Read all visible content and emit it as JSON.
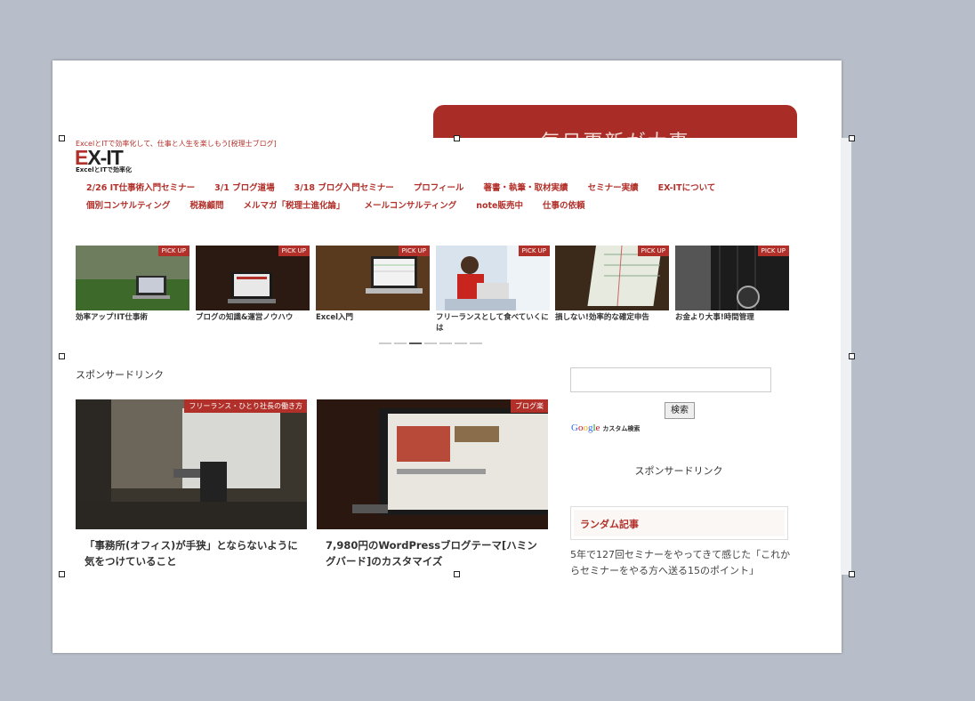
{
  "slide": {
    "banner_text": "毎日更新が大事"
  },
  "site": {
    "tagline": "ExcelとITで効率化して、仕事と人生を楽しもう[税理士ブログ]",
    "logo_main": "X-IT",
    "logo_e": "E",
    "logo_sub": "ExcelとITで効率化",
    "nav_row1": [
      "2/26 IT仕事術入門セミナー",
      "3/1 ブログ道場",
      "3/18 ブログ入門セミナー",
      "プロフィール",
      "著書・執筆・取材実績",
      "セミナー実績",
      "EX-ITについて"
    ],
    "nav_row2": [
      "個別コンサルティング",
      "税務顧問",
      "メルマガ「税理士進化論」",
      "メールコンサルティング",
      "note販売中",
      "仕事の依頼"
    ],
    "pickup_tag": "PICK UP",
    "pickups": [
      {
        "caption": "効率アップ!IT仕事術"
      },
      {
        "caption": "ブログの知識&運営ノウハウ"
      },
      {
        "caption": "Excel入門"
      },
      {
        "caption": "フリーランスとして食べていくには"
      },
      {
        "caption": "損しない!効率的な確定申告"
      },
      {
        "caption": "お金より大事!時間管理"
      }
    ],
    "sponsor_label": "スポンサードリンク",
    "cards": [
      {
        "tag": "フリーランス・ひとり社長の働き方",
        "title": "「事務所(オフィス)が手狭」とならないように気をつけていること"
      },
      {
        "tag": "ブログ楽",
        "title": "7,980円のWordPressブログテーマ[ハミングバード]のカスタマイズ"
      }
    ],
    "search_button": "検索",
    "google_custom": "カスタム検索",
    "sponsor_right": "スポンサードリンク",
    "random_heading": "ランダム記事",
    "random_article": "5年で127回セミナーをやってきて感じた「これからセミナーをやる方へ送る15のポイント」"
  },
  "colors": {
    "accent": "#b2302a",
    "banner": "#a92c26",
    "background": "#b8bec9"
  }
}
